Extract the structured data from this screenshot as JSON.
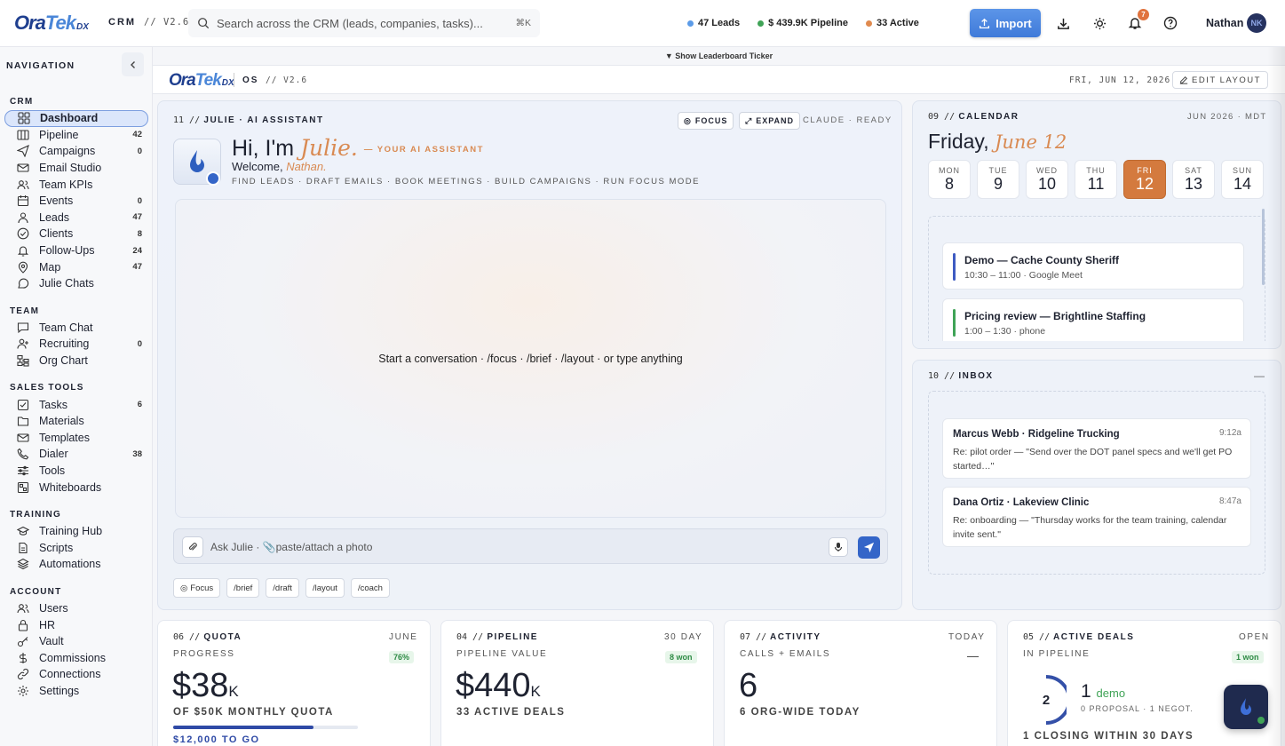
{
  "topbar": {
    "brand": "OraTek",
    "brand_suffix": "DX",
    "app_tag": "CRM",
    "version": "// V2.6",
    "search_placeholder": "Search across the CRM (leads, companies, tasks)...",
    "search_shortcut": "⌘K",
    "stats": [
      {
        "label": "47 Leads",
        "color": "#5b9be8"
      },
      {
        "label": "$ 439.9K Pipeline",
        "color": "#3fa356"
      },
      {
        "label": "33 Active",
        "color": "#e08a4e"
      }
    ],
    "import_label": "Import",
    "notifications_count": "7",
    "user_name": "Nathan",
    "user_initials": "NK"
  },
  "ticker": {
    "label": "▼ Show Leaderboard Ticker"
  },
  "sidebar": {
    "title": "NAVIGATION",
    "sections": [
      {
        "title": "CRM",
        "items": [
          {
            "label": "Dashboard",
            "icon": "grid-icon",
            "count": "",
            "active": true
          },
          {
            "label": "Pipeline",
            "icon": "columns-icon",
            "count": "42"
          },
          {
            "label": "Campaigns",
            "icon": "send-icon",
            "count": "0"
          },
          {
            "label": "Email Studio",
            "icon": "mail-icon",
            "count": ""
          },
          {
            "label": "Team KPIs",
            "icon": "users-icon",
            "count": ""
          },
          {
            "label": "Events",
            "icon": "calendar-icon",
            "count": "0"
          },
          {
            "label": "Leads",
            "icon": "user-icon",
            "count": "47"
          },
          {
            "label": "Clients",
            "icon": "check-circle-icon",
            "count": "8"
          },
          {
            "label": "Follow-Ups",
            "icon": "bell-icon",
            "count": "24"
          },
          {
            "label": "Map",
            "icon": "pin-icon",
            "count": "47"
          },
          {
            "label": "Julie Chats",
            "icon": "chat-icon",
            "count": ""
          }
        ]
      },
      {
        "title": "TEAM",
        "items": [
          {
            "label": "Team Chat",
            "icon": "message-icon",
            "count": ""
          },
          {
            "label": "Recruiting",
            "icon": "user-plus-icon",
            "count": "0"
          },
          {
            "label": "Org Chart",
            "icon": "org-icon",
            "count": ""
          }
        ]
      },
      {
        "title": "SALES TOOLS",
        "items": [
          {
            "label": "Tasks",
            "icon": "checkbox-icon",
            "count": "6"
          },
          {
            "label": "Materials",
            "icon": "folder-icon",
            "count": ""
          },
          {
            "label": "Templates",
            "icon": "mail-icon",
            "count": ""
          },
          {
            "label": "Dialer",
            "icon": "phone-icon",
            "count": "38"
          },
          {
            "label": "Tools",
            "icon": "sliders-icon",
            "count": ""
          },
          {
            "label": "Whiteboards",
            "icon": "board-icon",
            "count": ""
          }
        ]
      },
      {
        "title": "TRAINING",
        "items": [
          {
            "label": "Training Hub",
            "icon": "cap-icon",
            "count": ""
          },
          {
            "label": "Scripts",
            "icon": "doc-icon",
            "count": ""
          },
          {
            "label": "Automations",
            "icon": "layers-icon",
            "count": ""
          }
        ]
      },
      {
        "title": "ACCOUNT",
        "items": [
          {
            "label": "Users",
            "icon": "users-icon",
            "count": ""
          },
          {
            "label": "HR",
            "icon": "lock-icon",
            "count": ""
          },
          {
            "label": "Vault",
            "icon": "key-icon",
            "count": ""
          },
          {
            "label": "Commissions",
            "icon": "dollar-icon",
            "count": ""
          },
          {
            "label": "Connections",
            "icon": "link-icon",
            "count": ""
          },
          {
            "label": "Settings",
            "icon": "gear-icon",
            "count": ""
          }
        ]
      }
    ]
  },
  "subheader": {
    "tag": "OS",
    "version": "// V2.6",
    "date": "FRI, JUN 12, 2026",
    "edit_label": "EDIT LAYOUT"
  },
  "assistant": {
    "num": "11 //",
    "title": "JULIE · AI ASSISTANT",
    "focus_label": "FOCUS",
    "expand_label": "EXPAND",
    "status": "CLAUDE · READY",
    "greeting": "Hi, I'm",
    "name": "Julie.",
    "role": "— YOUR AI ASSISTANT",
    "welcome": "Welcome,",
    "user": "Nathan.",
    "capabilities": "FIND LEADS · DRAFT EMAILS · BOOK MEETINGS · BUILD CAMPAIGNS · RUN FOCUS MODE",
    "empty_prompt": "Start a conversation · /focus · /brief · /layout · or type anything",
    "input_placeholder": "Ask Julie · 📎paste/attach a photo",
    "quick": [
      "Focus",
      "/brief",
      "/draft",
      "/layout",
      "/coach"
    ]
  },
  "calendar": {
    "num": "09 //",
    "title": "CALENDAR",
    "month_tz": "JUN 2026 · MDT",
    "weekday": "Friday,",
    "date": "June 12",
    "days": [
      {
        "d": "MON",
        "n": "8"
      },
      {
        "d": "TUE",
        "n": "9"
      },
      {
        "d": "WED",
        "n": "10"
      },
      {
        "d": "THU",
        "n": "11"
      },
      {
        "d": "FRI",
        "n": "12",
        "sel": true
      },
      {
        "d": "SAT",
        "n": "13"
      },
      {
        "d": "SUN",
        "n": "14"
      }
    ],
    "events": [
      {
        "title": "Demo — Cache County Sheriff",
        "meta": "10:30 – 11:00 · Google Meet",
        "color": "#3e5bc2"
      },
      {
        "title": "Pricing review — Brightline Staffing",
        "meta": "1:00 – 1:30 · phone",
        "color": "#3fa356"
      }
    ]
  },
  "inbox": {
    "num": "10 //",
    "title": "INBOX",
    "collapse": "—",
    "messages": [
      {
        "from": "Marcus Webb · Ridgeline Trucking",
        "time": "9:12a",
        "body": "Re: pilot order — \"Send over the DOT panel specs and we'll get PO started…\""
      },
      {
        "from": "Dana Ortiz · Lakeview Clinic",
        "time": "8:47a",
        "body": "Re: onboarding — \"Thursday works for the team training, calendar invite sent.\""
      }
    ]
  },
  "kpis": {
    "quota": {
      "num": "06 //",
      "title": "QUOTA",
      "period": "JUNE",
      "sub": "PROGRESS",
      "badge": "76%",
      "value": "$38",
      "unit": "K",
      "caption": "OF $50K MONTHLY QUOTA",
      "progress": 0.76,
      "footer": "$12,000 TO GO"
    },
    "pipeline": {
      "num": "04 //",
      "title": "PIPELINE",
      "period": "30 DAY",
      "sub": "PIPELINE VALUE",
      "badge": "8 won",
      "value": "$440",
      "unit": "K",
      "caption": "33 ACTIVE DEALS"
    },
    "activity": {
      "num": "07 //",
      "title": "ACTIVITY",
      "period": "TODAY",
      "sub": "CALLS + EMAILS",
      "badge": "—",
      "value": "6",
      "caption": "6 ORG-WIDE TODAY"
    },
    "deals": {
      "num": "05 //",
      "title": "ACTIVE DEALS",
      "period": "OPEN",
      "sub": "IN PIPELINE",
      "badge": "1 won",
      "ring": "2",
      "count": "1",
      "count_label": "demo",
      "breakdown": "0 PROPOSAL · 1 NEGOT.",
      "footer": "1 CLOSING WITHIN 30 DAYS"
    }
  }
}
